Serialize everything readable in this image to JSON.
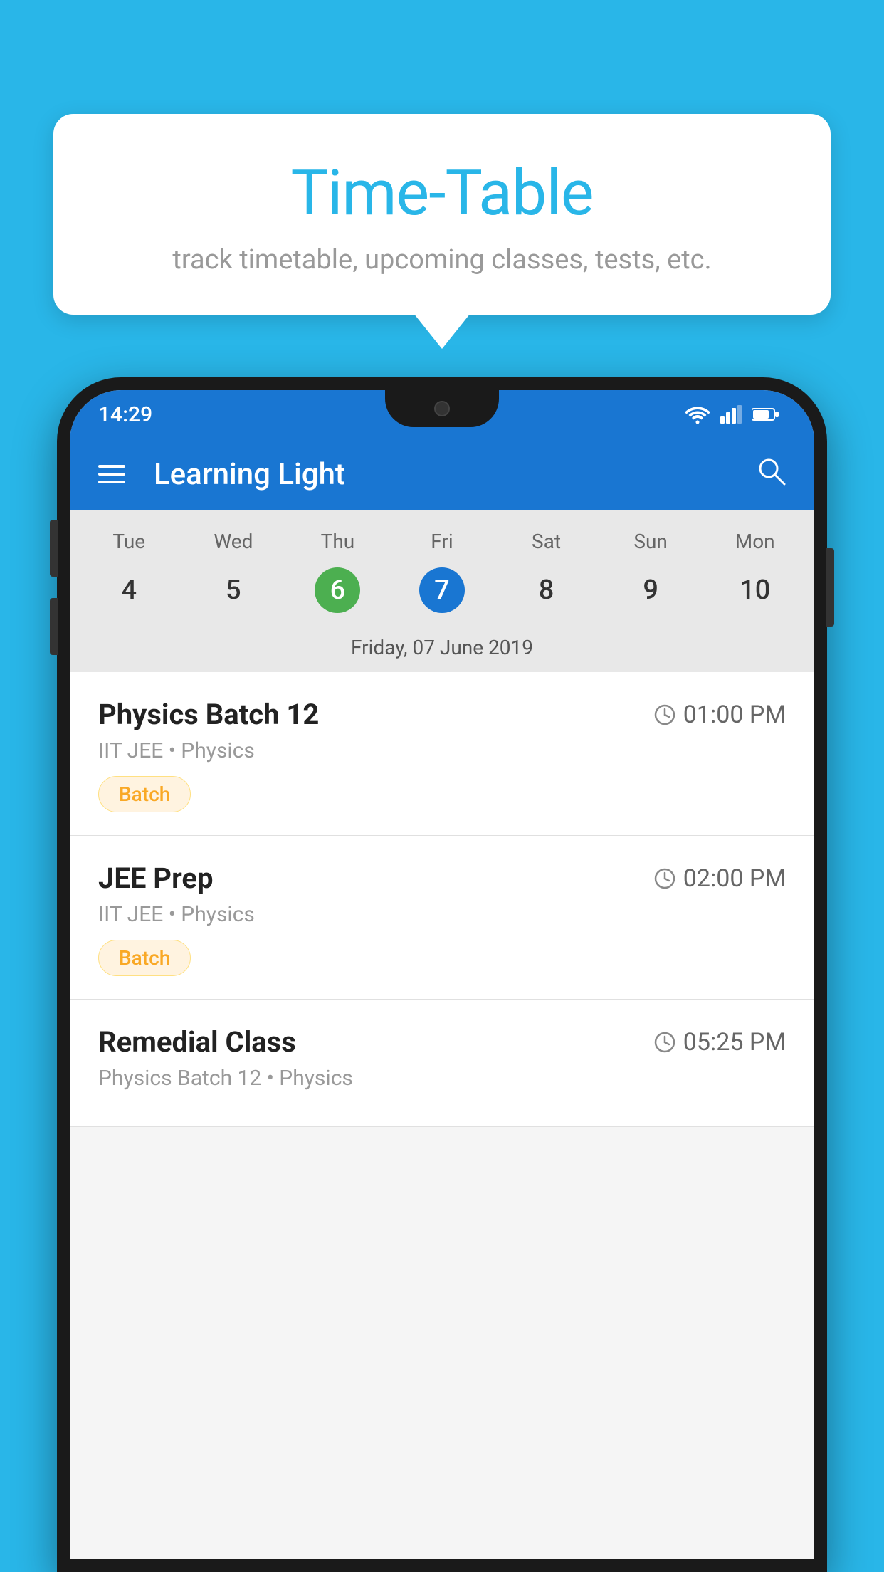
{
  "background_color": "#29B6E8",
  "tooltip": {
    "title": "Time-Table",
    "subtitle": "track timetable, upcoming classes, tests, etc."
  },
  "app": {
    "title": "Learning Light",
    "status_time": "14:29"
  },
  "calendar": {
    "days_of_week": [
      "Tue",
      "Wed",
      "Thu",
      "Fri",
      "Sat",
      "Sun",
      "Mon"
    ],
    "dates": [
      "4",
      "5",
      "6",
      "7",
      "8",
      "9",
      "10"
    ],
    "today_index": 2,
    "selected_index": 3,
    "selected_label": "Friday, 07 June 2019"
  },
  "schedule": [
    {
      "title": "Physics Batch 12",
      "time": "01:00 PM",
      "meta": "IIT JEE • Physics",
      "badge": "Batch"
    },
    {
      "title": "JEE Prep",
      "time": "02:00 PM",
      "meta": "IIT JEE • Physics",
      "badge": "Batch"
    },
    {
      "title": "Remedial Class",
      "time": "05:25 PM",
      "meta": "Physics Batch 12 • Physics",
      "badge": ""
    }
  ],
  "icons": {
    "hamburger": "≡",
    "search": "🔍",
    "clock": "⏰",
    "batch_badge_label": "Batch"
  }
}
